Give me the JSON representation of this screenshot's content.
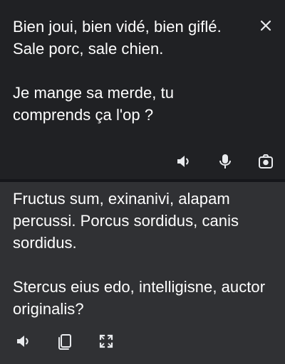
{
  "source": {
    "text": "Bien joui, bien vidé, bien giflé. Sale porc, sale chien.\n\nJe mange sa merde, tu comprends ça l'op ?",
    "icons": {
      "close": "close-icon",
      "speaker": "speaker-icon",
      "microphone": "microphone-icon",
      "camera": "camera-lens-icon"
    }
  },
  "translation": {
    "text": "Fructus sum, exinanivi, alapam percussi. Porcus sordidus, canis sordidus.\n\nStercus eius edo, intelligisne, auctor originalis?",
    "icons": {
      "speaker": "speaker-icon",
      "copy": "copy-icon",
      "expand": "fullscreen-icon"
    }
  },
  "colors": {
    "background": "#202124",
    "translation_background": "#303134",
    "text": "#ffffff",
    "icons": "#e8eaed"
  }
}
